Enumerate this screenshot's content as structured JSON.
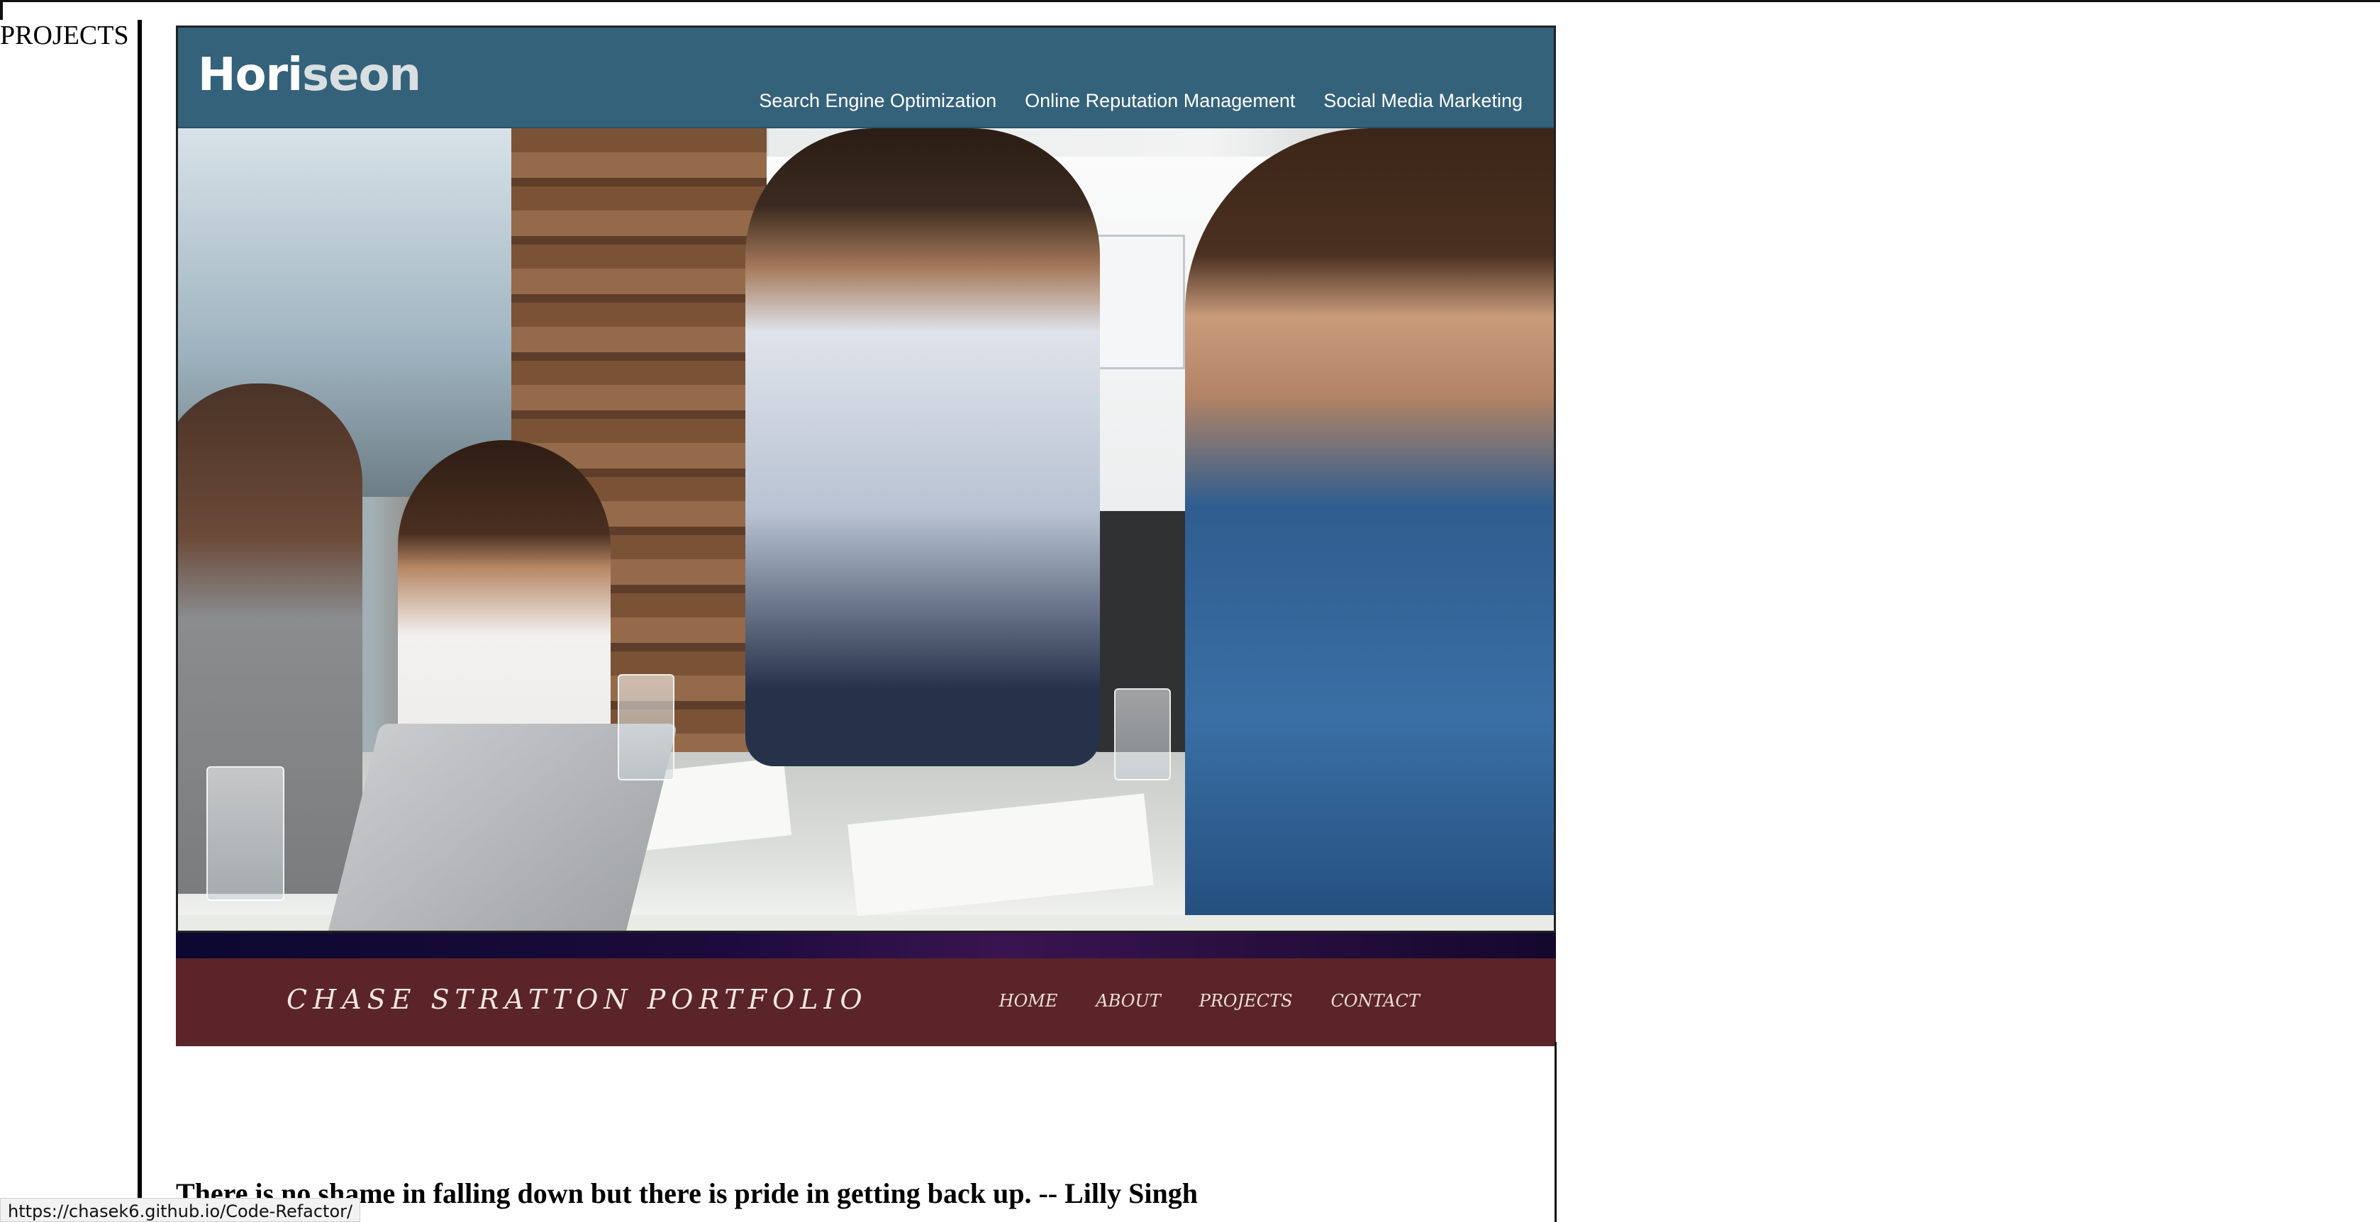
{
  "sidebar": {
    "label": "PROJECTS"
  },
  "horiseon": {
    "logo_main": "Hori",
    "logo_accent": "seon",
    "nav": [
      "Search Engine Optimization",
      "Online Reputation Management",
      "Social Media Marketing"
    ],
    "header_color": "#34627a"
  },
  "portfolio": {
    "title": "CHASE STRATTON PORTFOLIO",
    "nav": [
      "HOME",
      "ABOUT",
      "PROJECTS",
      "CONTACT"
    ],
    "band_color": "#5a2429"
  },
  "quote": "There is no shame in falling down but there is pride in getting back up. -- Lilly Singh",
  "status_bar": {
    "url": "https://chasek6.github.io/Code-Refactor/"
  }
}
